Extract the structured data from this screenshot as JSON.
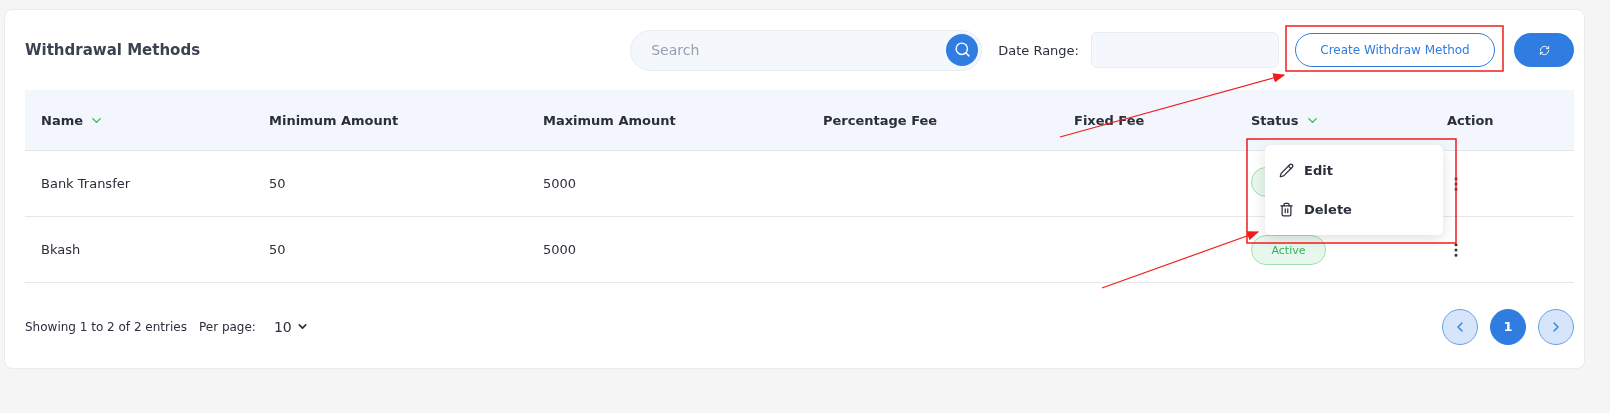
{
  "title": "Withdrawal Methods",
  "search": {
    "placeholder": "Search"
  },
  "date_range": {
    "label": "Date Range:"
  },
  "create_button": "Create Withdraw Method",
  "columns": [
    {
      "label": "Name",
      "sortable": true
    },
    {
      "label": "Minimum Amount",
      "sortable": false
    },
    {
      "label": "Maximum Amount",
      "sortable": false
    },
    {
      "label": "Percentage Fee",
      "sortable": false
    },
    {
      "label": "Fixed Fee",
      "sortable": false
    },
    {
      "label": "Status",
      "sortable": true
    },
    {
      "label": "Action",
      "sortable": false
    }
  ],
  "rows": [
    {
      "name": "Bank Transfer",
      "minimum_amount": "50",
      "maximum_amount": "5000",
      "status_covered": true,
      "menu_open": true
    },
    {
      "name": "Bkash",
      "minimum_amount": "50",
      "maximum_amount": "5000",
      "status": "Active",
      "menu_open": false
    }
  ],
  "action_menu": [
    {
      "kind": "edit",
      "label": "Edit"
    },
    {
      "kind": "delete",
      "label": "Delete"
    }
  ],
  "footer": {
    "summary": "Showing 1 to 2 of 2 entries",
    "per_page_label": "Per page:",
    "per_page": "10"
  },
  "pagination": [
    {
      "label": "1",
      "selected": true
    }
  ]
}
